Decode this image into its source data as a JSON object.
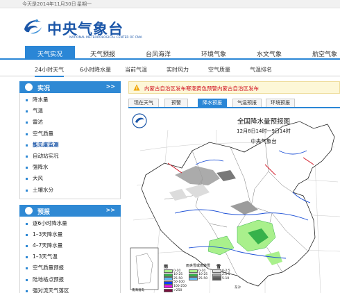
{
  "topbar": {
    "date": "今天是2014年11月30日",
    "weekday": "星期一"
  },
  "logo": {
    "name": "中央气象台",
    "en": "NATIONAL METEOROLOGICAL CENTER OF CMA"
  },
  "main_nav": [
    "天气实况",
    "天气预报",
    "台风海洋",
    "环境气象",
    "水文气象",
    "航空气象"
  ],
  "sub_nav": [
    "24小时天气",
    "6小时降水量",
    "当前气温",
    "实时风力",
    "空气质量",
    "气温排名"
  ],
  "sidebar": {
    "section1": {
      "title": "实况",
      "more": ">>",
      "items": [
        "降水量",
        "气温",
        "雷达",
        "空气质量",
        "能见度监测",
        "自动站实况",
        "强降水",
        "大风",
        "土壤水分"
      ]
    },
    "section2": {
      "title": "预报",
      "more": ">>",
      "items": [
        "逐6小时降水量",
        "1–3天降水量",
        "4–7天降水量",
        "1–3天气温",
        "空气质量预报",
        "陆地格点预报",
        "强对流天气落区"
      ]
    }
  },
  "alert": {
    "text": "内蒙古自治区发布寒潮黄色预警内蒙古自治区发布"
  },
  "tabs": [
    "现在天气",
    "预警",
    "降水预报",
    "气温预报",
    "环境预报"
  ],
  "map": {
    "title": "全国降水量预报图",
    "subtitle": "12月8日14时一9日14时",
    "org": "中央气象台",
    "legend": {
      "rain_label": "雨",
      "mixed_label": "雨夹雪或雨转雪",
      "snow_label": "雪",
      "rain_values": [
        "0-10",
        "10-25",
        "25-50",
        "50-100",
        "100-250",
        ">250"
      ],
      "mixed_values": [
        "0-10",
        "10-25",
        "25-50"
      ],
      "snow_values": [
        "0-2.5",
        "2.5-5",
        "5-10"
      ],
      "rain_colors": [
        "#a9f08c",
        "#36b24b",
        "#5fb8f0",
        "#0a3df6",
        "#f212f2",
        "#7a0f3d"
      ],
      "snow_colors": [
        "#dcdcdc",
        "#9c9c9c",
        "#585858"
      ],
      "inset_label": "南海诸岛",
      "place_label": "东沙"
    }
  },
  "colors": {
    "accent": "#2a86d6",
    "logo_blue": "#1b56a8",
    "alert_red": "#d0101f"
  }
}
